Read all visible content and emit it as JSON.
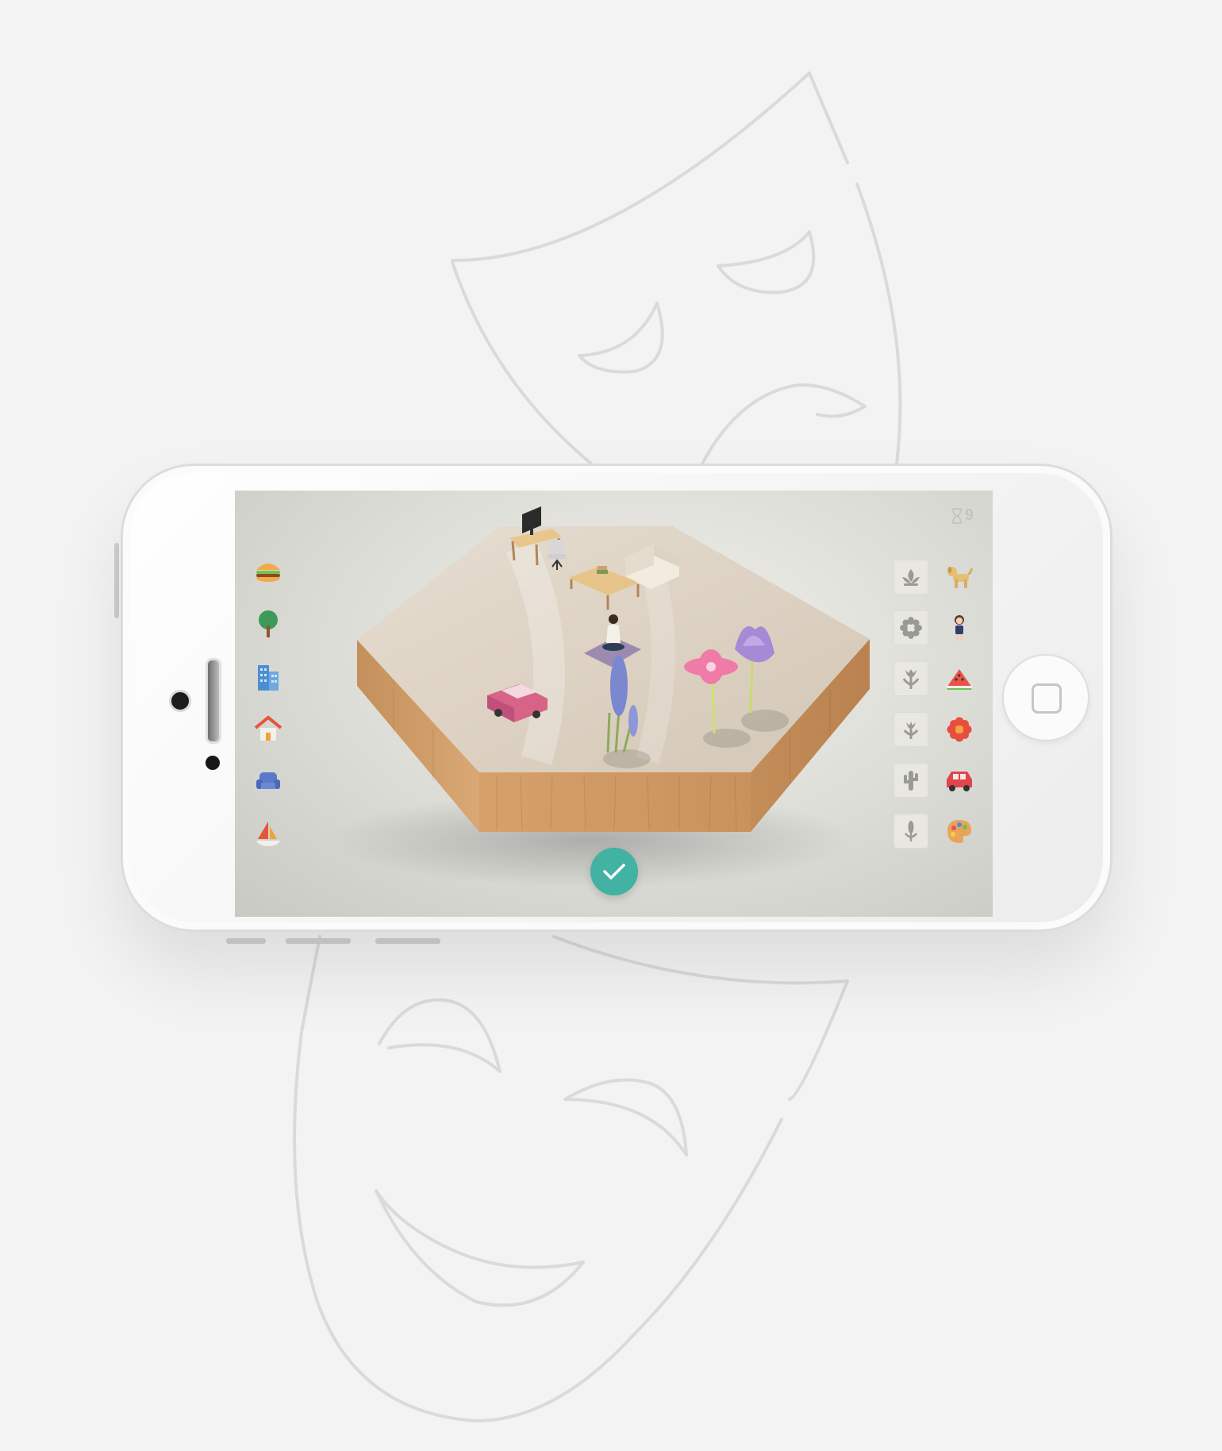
{
  "background": {
    "color": "#f3f3f3",
    "decoration": "theater-masks-outline"
  },
  "device": {
    "type": "smartphone-landscape",
    "home_button_icon": "square-icon"
  },
  "game": {
    "timer": {
      "icon": "hourglass-icon",
      "value": "9"
    },
    "left_toolbar": [
      {
        "icon": "burger-icon"
      },
      {
        "icon": "tree-icon"
      },
      {
        "icon": "building-icon"
      },
      {
        "icon": "house-icon"
      },
      {
        "icon": "armchair-icon"
      },
      {
        "icon": "sailboat-icon"
      }
    ],
    "right_toolbar": {
      "slots": [
        {
          "icon": "lotus-silhouette-icon"
        },
        {
          "icon": "daisy-silhouette-icon"
        },
        {
          "icon": "tulip-silhouette-icon"
        },
        {
          "icon": "tulip-small-silhouette-icon"
        },
        {
          "icon": "cactus-silhouette-icon"
        },
        {
          "icon": "lavender-silhouette-icon"
        }
      ],
      "palette": [
        {
          "icon": "dog-icon"
        },
        {
          "icon": "girl-icon"
        },
        {
          "icon": "watermelon-icon"
        },
        {
          "icon": "flower-icon"
        },
        {
          "icon": "car-icon"
        },
        {
          "icon": "paint-palette-icon"
        }
      ]
    },
    "board": {
      "items": [
        "desk-with-monitor",
        "office-chair",
        "coffee-table",
        "armchair",
        "yoga-person",
        "pink-car",
        "lavender-plant",
        "pink-daisy",
        "purple-tulip"
      ]
    },
    "confirm_button": {
      "icon": "checkmark-icon"
    },
    "accent_color": "#42b2a2"
  }
}
